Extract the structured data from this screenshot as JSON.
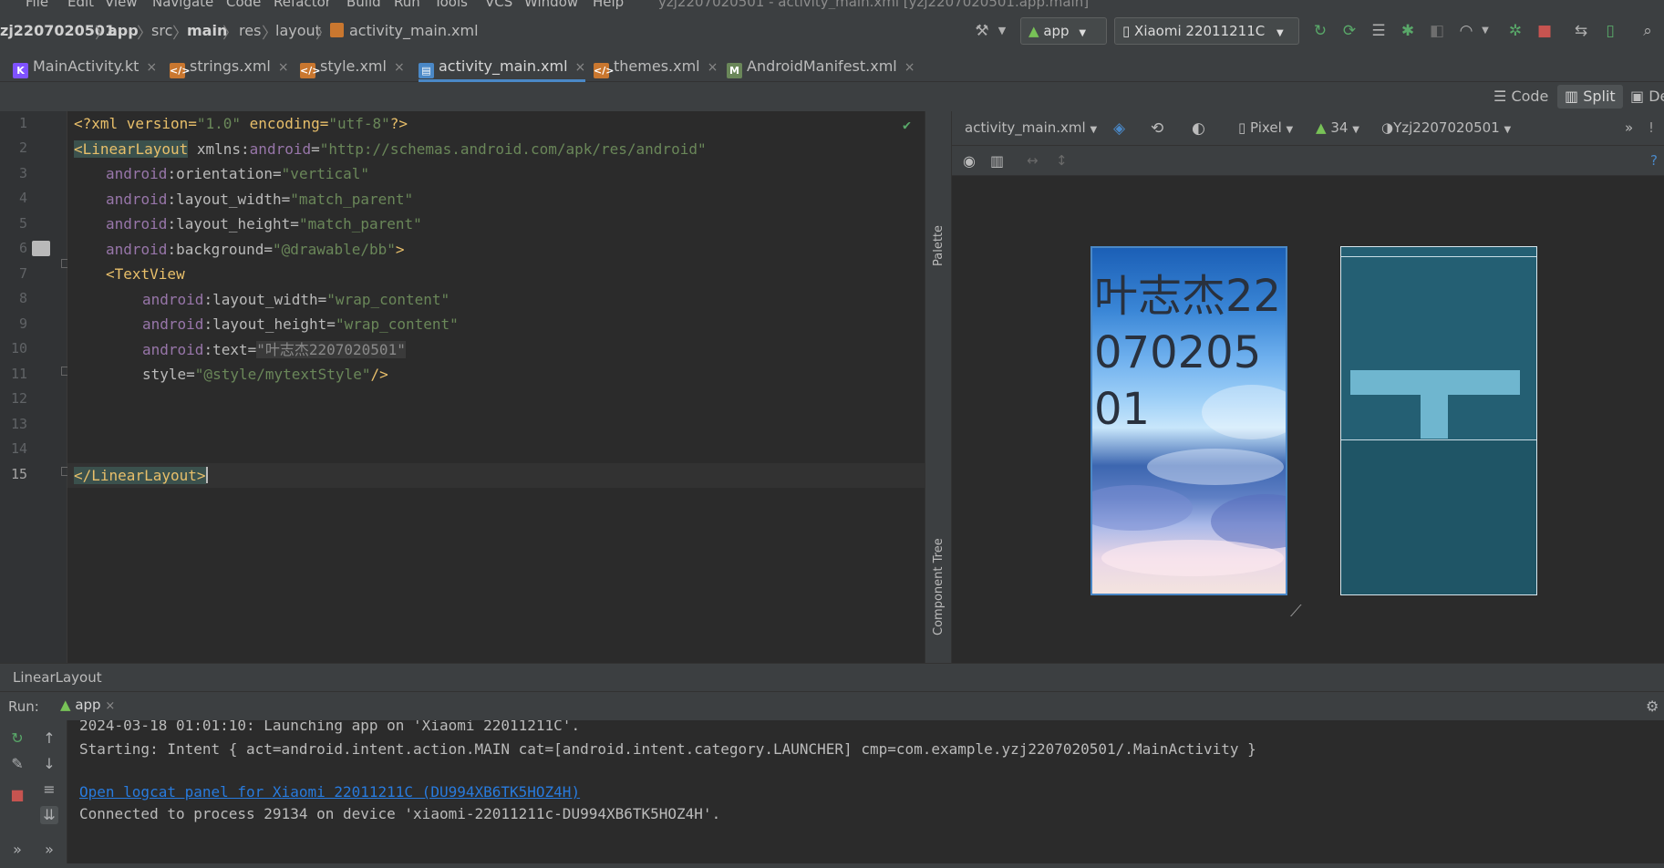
{
  "menu": [
    "File",
    "Edit",
    "View",
    "Navigate",
    "Code",
    "Refactor",
    "Build",
    "Run",
    "Tools",
    "VCS",
    "Window",
    "Help"
  ],
  "window_title": "yzj2207020501 - activity_main.xml [yzj2207020501.app.main]",
  "breadcrumb": [
    "zj2207020501",
    "app",
    "src",
    "main",
    "res",
    "layout",
    "activity_main.xml"
  ],
  "toolbar": {
    "run_config": "app",
    "device": "Xiaomi 22011211C"
  },
  "tabs": [
    {
      "label": "MainActivity.kt",
      "active": false
    },
    {
      "label": "strings.xml",
      "active": false
    },
    {
      "label": "style.xml",
      "active": false
    },
    {
      "label": "activity_main.xml",
      "active": true
    },
    {
      "label": "themes.xml",
      "active": false
    },
    {
      "label": "AndroidManifest.xml",
      "active": false
    }
  ],
  "view_modes": {
    "code": "Code",
    "split": "Split",
    "design": "De"
  },
  "editor": {
    "line_numbers": [
      "1",
      "2",
      "3",
      "4",
      "5",
      "6",
      "7",
      "8",
      "9",
      "10",
      "11",
      "12",
      "13",
      "14",
      "15"
    ],
    "current_line": "15",
    "code": {
      "l1_a": "<?xml version=",
      "l1_v1": "\"1.0\"",
      "l1_b": " encoding=",
      "l1_v2": "\"utf-8\"",
      "l1_c": "?>",
      "l2_lt": "<",
      "l2_tag": "LinearLayout",
      "l2_attr": " xmlns:",
      "l2_ns": "android",
      "l2_eq": "=",
      "l2_val": "\"http://schemas.android.com/apk/res/android\"",
      "l3_ns": "android",
      "l3_attr": ":orientation=",
      "l3_val": "\"vertical\"",
      "l4_ns": "android",
      "l4_attr": ":layout_width=",
      "l4_val": "\"match_parent\"",
      "l5_ns": "android",
      "l5_attr": ":layout_height=",
      "l5_val": "\"match_parent\"",
      "l6_ns": "android",
      "l6_attr": ":background=",
      "l6_val": "\"@drawable/bb\"",
      "l6_end": ">",
      "l7_tag": "<TextView",
      "l8_ns": "android",
      "l8_attr": ":layout_width=",
      "l8_val": "\"wrap_content\"",
      "l9_ns": "android",
      "l9_attr": ":layout_height=",
      "l9_val": "\"wrap_content\"",
      "l10_ns": "android",
      "l10_attr": ":text=",
      "l10_val": "\"叶志杰2207020501\"",
      "l11_attr": "style=",
      "l11_val": "\"@style/mytextStyle\"",
      "l11_end": "/>",
      "l15_open": "</",
      "l15_tag": "LinearLayout",
      "l15_close": ">"
    }
  },
  "palette_label": "Palette",
  "component_tree_label": "Component Tree",
  "design_toolbar": {
    "file": "activity_main.xml",
    "device": "Pixel",
    "api": "34",
    "theme": "Yzj2207020501"
  },
  "preview_text": "叶志杰2207020501",
  "status_path": "LinearLayout",
  "run": {
    "label": "Run:",
    "tab": "app",
    "console": [
      "2024-03-18 01:01:10: Launching app on 'Xiaomi 22011211C'.",
      "Starting: Intent { act=android.intent.action.MAIN cat=[android.intent.category.LAUNCHER] cmp=com.example.yzj2207020501/.MainActivity }",
      "",
      "Open logcat panel for Xiaomi 22011211C (DU994XB6TK5HOZ4H)",
      "Connected to process 29134 on device 'xiaomi-22011211c-DU994XB6TK5HOZ4H'."
    ]
  },
  "colors": {
    "accent": "#4a88c7",
    "tag": "#e8bf6a",
    "value": "#6a8759",
    "namespace": "#9876aa",
    "link": "#287bde"
  }
}
